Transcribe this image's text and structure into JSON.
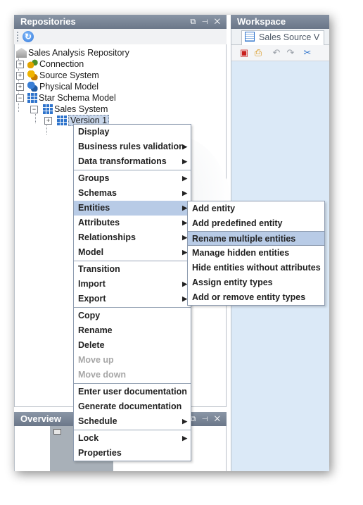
{
  "repositories": {
    "title": "Repositories",
    "win_controls": "⧉ ⊣ ✕",
    "tree": [
      {
        "label": "Sales Analysis Repository",
        "icon": "repository-icon"
      },
      {
        "label": "Connection",
        "icon": "connection-icon"
      },
      {
        "label": "Source System",
        "icon": "source-system-icon"
      },
      {
        "label": "Physical Model",
        "icon": "physical-model-icon"
      },
      {
        "label": "Star Schema Model",
        "icon": "star-schema-icon"
      },
      {
        "label": "Sales System",
        "icon": "sales-system-icon"
      },
      {
        "label": "Version 1",
        "icon": "version-icon"
      }
    ]
  },
  "overview": {
    "title": "Overview",
    "win_controls": "⧉ ⊣ ✕"
  },
  "workspace": {
    "title": "Workspace",
    "tab_label": "Sales Source V"
  },
  "context_menu": {
    "groups": [
      [
        {
          "label": "Display",
          "submenu": false,
          "disabled": false
        },
        {
          "label": "Business rules validation",
          "submenu": true,
          "disabled": false
        },
        {
          "label": "Data transformations",
          "submenu": true,
          "disabled": false
        }
      ],
      [
        {
          "label": "Groups",
          "submenu": true,
          "disabled": false
        },
        {
          "label": "Schemas",
          "submenu": true,
          "disabled": false
        },
        {
          "label": "Entities",
          "submenu": true,
          "disabled": false
        },
        {
          "label": "Attributes",
          "submenu": true,
          "disabled": false
        },
        {
          "label": "Relationships",
          "submenu": true,
          "disabled": false
        },
        {
          "label": "Model",
          "submenu": true,
          "disabled": false
        }
      ],
      [
        {
          "label": "Transition",
          "submenu": false,
          "disabled": false
        },
        {
          "label": "Import",
          "submenu": true,
          "disabled": false
        },
        {
          "label": "Export",
          "submenu": true,
          "disabled": false
        }
      ],
      [
        {
          "label": "Copy",
          "submenu": false,
          "disabled": false
        },
        {
          "label": "Rename",
          "submenu": false,
          "disabled": false
        },
        {
          "label": "Delete",
          "submenu": false,
          "disabled": false
        },
        {
          "label": "Move up",
          "submenu": false,
          "disabled": true
        },
        {
          "label": "Move down",
          "submenu": false,
          "disabled": true
        }
      ],
      [
        {
          "label": "Enter user documentation",
          "submenu": false,
          "disabled": false
        },
        {
          "label": "Generate documentation",
          "submenu": false,
          "disabled": false
        },
        {
          "label": "Schedule",
          "submenu": true,
          "disabled": false
        }
      ],
      [
        {
          "label": "Lock",
          "submenu": true,
          "disabled": false
        },
        {
          "label": "Properties",
          "submenu": false,
          "disabled": false
        }
      ]
    ]
  },
  "entities_submenu": {
    "items": [
      {
        "label": "Add entity"
      },
      {
        "label": "Add predefined entity"
      },
      {
        "label": "Rename multiple entities"
      },
      {
        "label": "Manage hidden entities"
      },
      {
        "label": "Hide entities without attributes"
      },
      {
        "label": "Assign entity types"
      },
      {
        "label": "Add or remove entity types"
      }
    ]
  }
}
